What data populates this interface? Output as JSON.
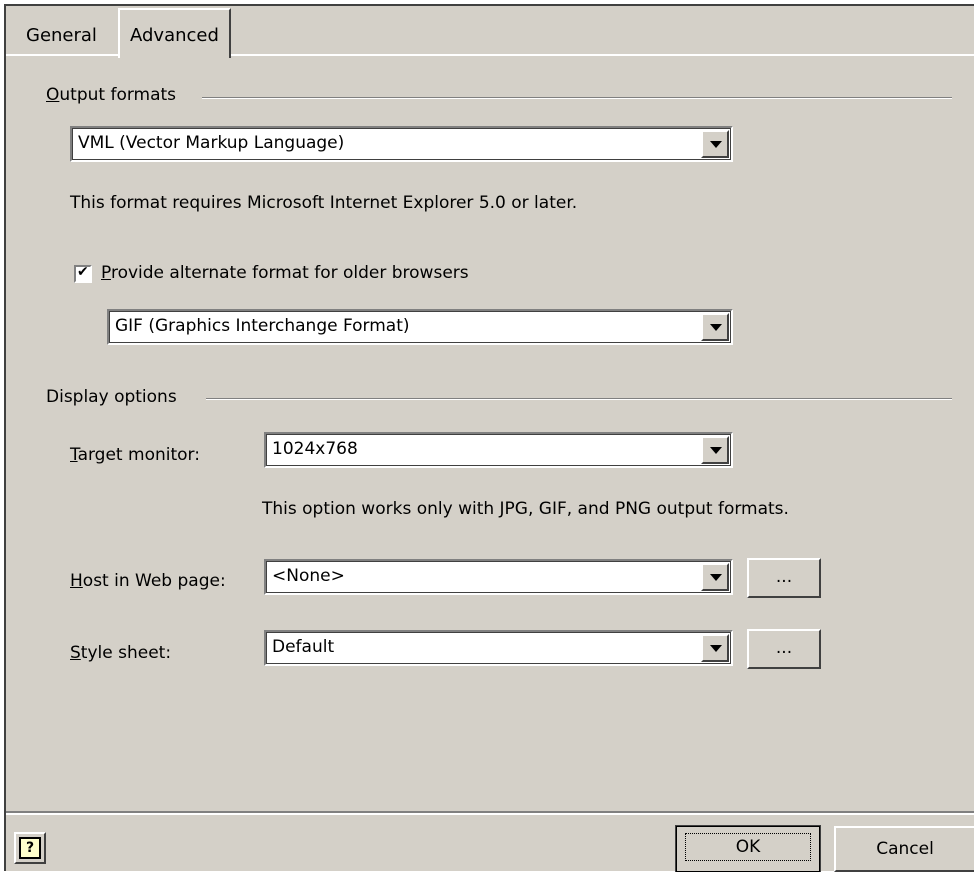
{
  "tabs": [
    {
      "label": "General",
      "active": false
    },
    {
      "label": "Advanced",
      "active": true
    }
  ],
  "output_formats": {
    "group_label_key": "O",
    "group_label_rest": "utput formats",
    "format_select_value": "VML (Vector Markup Language)",
    "requirement_text": "This format requires Microsoft Internet Explorer 5.0 or later.",
    "alternate_checkbox_checked": true,
    "alternate_label_key": "P",
    "alternate_label_rest": "rovide alternate format for older browsers",
    "alternate_select_value": "GIF (Graphics Interchange Format)"
  },
  "display_options": {
    "group_label": "Display options",
    "target_monitor_key": "T",
    "target_monitor_rest": "arget monitor:",
    "target_monitor_value": "1024x768",
    "note_text": "This option works only with JPG, GIF, and PNG output formats.",
    "host_key": "H",
    "host_rest": "ost in Web page:",
    "host_value": "<None>",
    "host_browse_label": "...",
    "style_key": "S",
    "style_rest": "tyle sheet:",
    "style_value": "Default",
    "style_browse_label": "..."
  },
  "footer": {
    "help_icon": "help-question-icon",
    "ok_label": "OK",
    "cancel_label": "Cancel"
  }
}
